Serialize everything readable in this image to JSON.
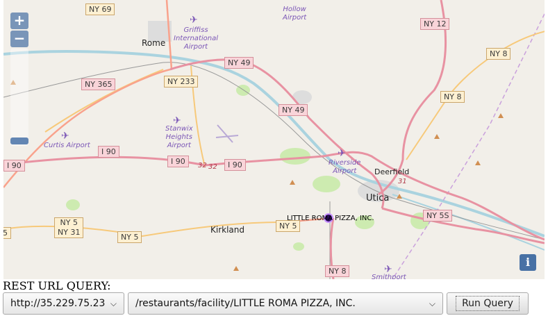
{
  "map": {
    "zoom_in": "+",
    "zoom_out": "−",
    "info": "i",
    "places": {
      "rome": "Rome",
      "utica": "Utica",
      "deerfield": "Deerfield",
      "kirkland": "Kirkland"
    },
    "airports": {
      "hollow": "Hollow\nAirport",
      "griffiss": "Griffiss\nInternational\nAirport",
      "curtis": "Curtis Airport",
      "stanwix": "Stanwix\nHeights\nAirport",
      "riverside": "Riverside\nAirport",
      "smithport": "Smithport"
    },
    "shields": {
      "ny69": "NY 69",
      "ny12": "NY 12",
      "ny8_a": "NY 8",
      "ny49_a": "NY 49",
      "ny365": "NY 365",
      "ny233": "NY 233",
      "ny8_b": "NY 8",
      "ny49_b": "NY 49",
      "i90_a": "I 90",
      "i90_b": "I 90",
      "i90_c": "I 90",
      "i90_d": "I 90",
      "ny5_a": "NY 5\nNY 31",
      "ny5_b": "NY 5",
      "ny5_c": "NY 5",
      "ny5_d": "5",
      "ny5s": "NY 5S",
      "ny8_c": "NY 8"
    },
    "route_numbers": {
      "r32a": "32",
      "r32b": "32",
      "r31": "31"
    },
    "marker_label": "LITTLE ROMA PIZZA, INC.",
    "colors": {
      "land": "#f2efe9",
      "motorway": "#e892a2",
      "trunk": "#f9b29c",
      "primary": "#fcd6a4",
      "water": "#aad3df",
      "park": "#c8facc",
      "marker": "#2c0b5e"
    }
  },
  "query": {
    "label": "REST URL QUERY:",
    "host_value": "http://35.229.75.23",
    "path_value": "/restaurants/facility/LITTLE ROMA PIZZA, INC.",
    "run_label": "Run Query"
  }
}
